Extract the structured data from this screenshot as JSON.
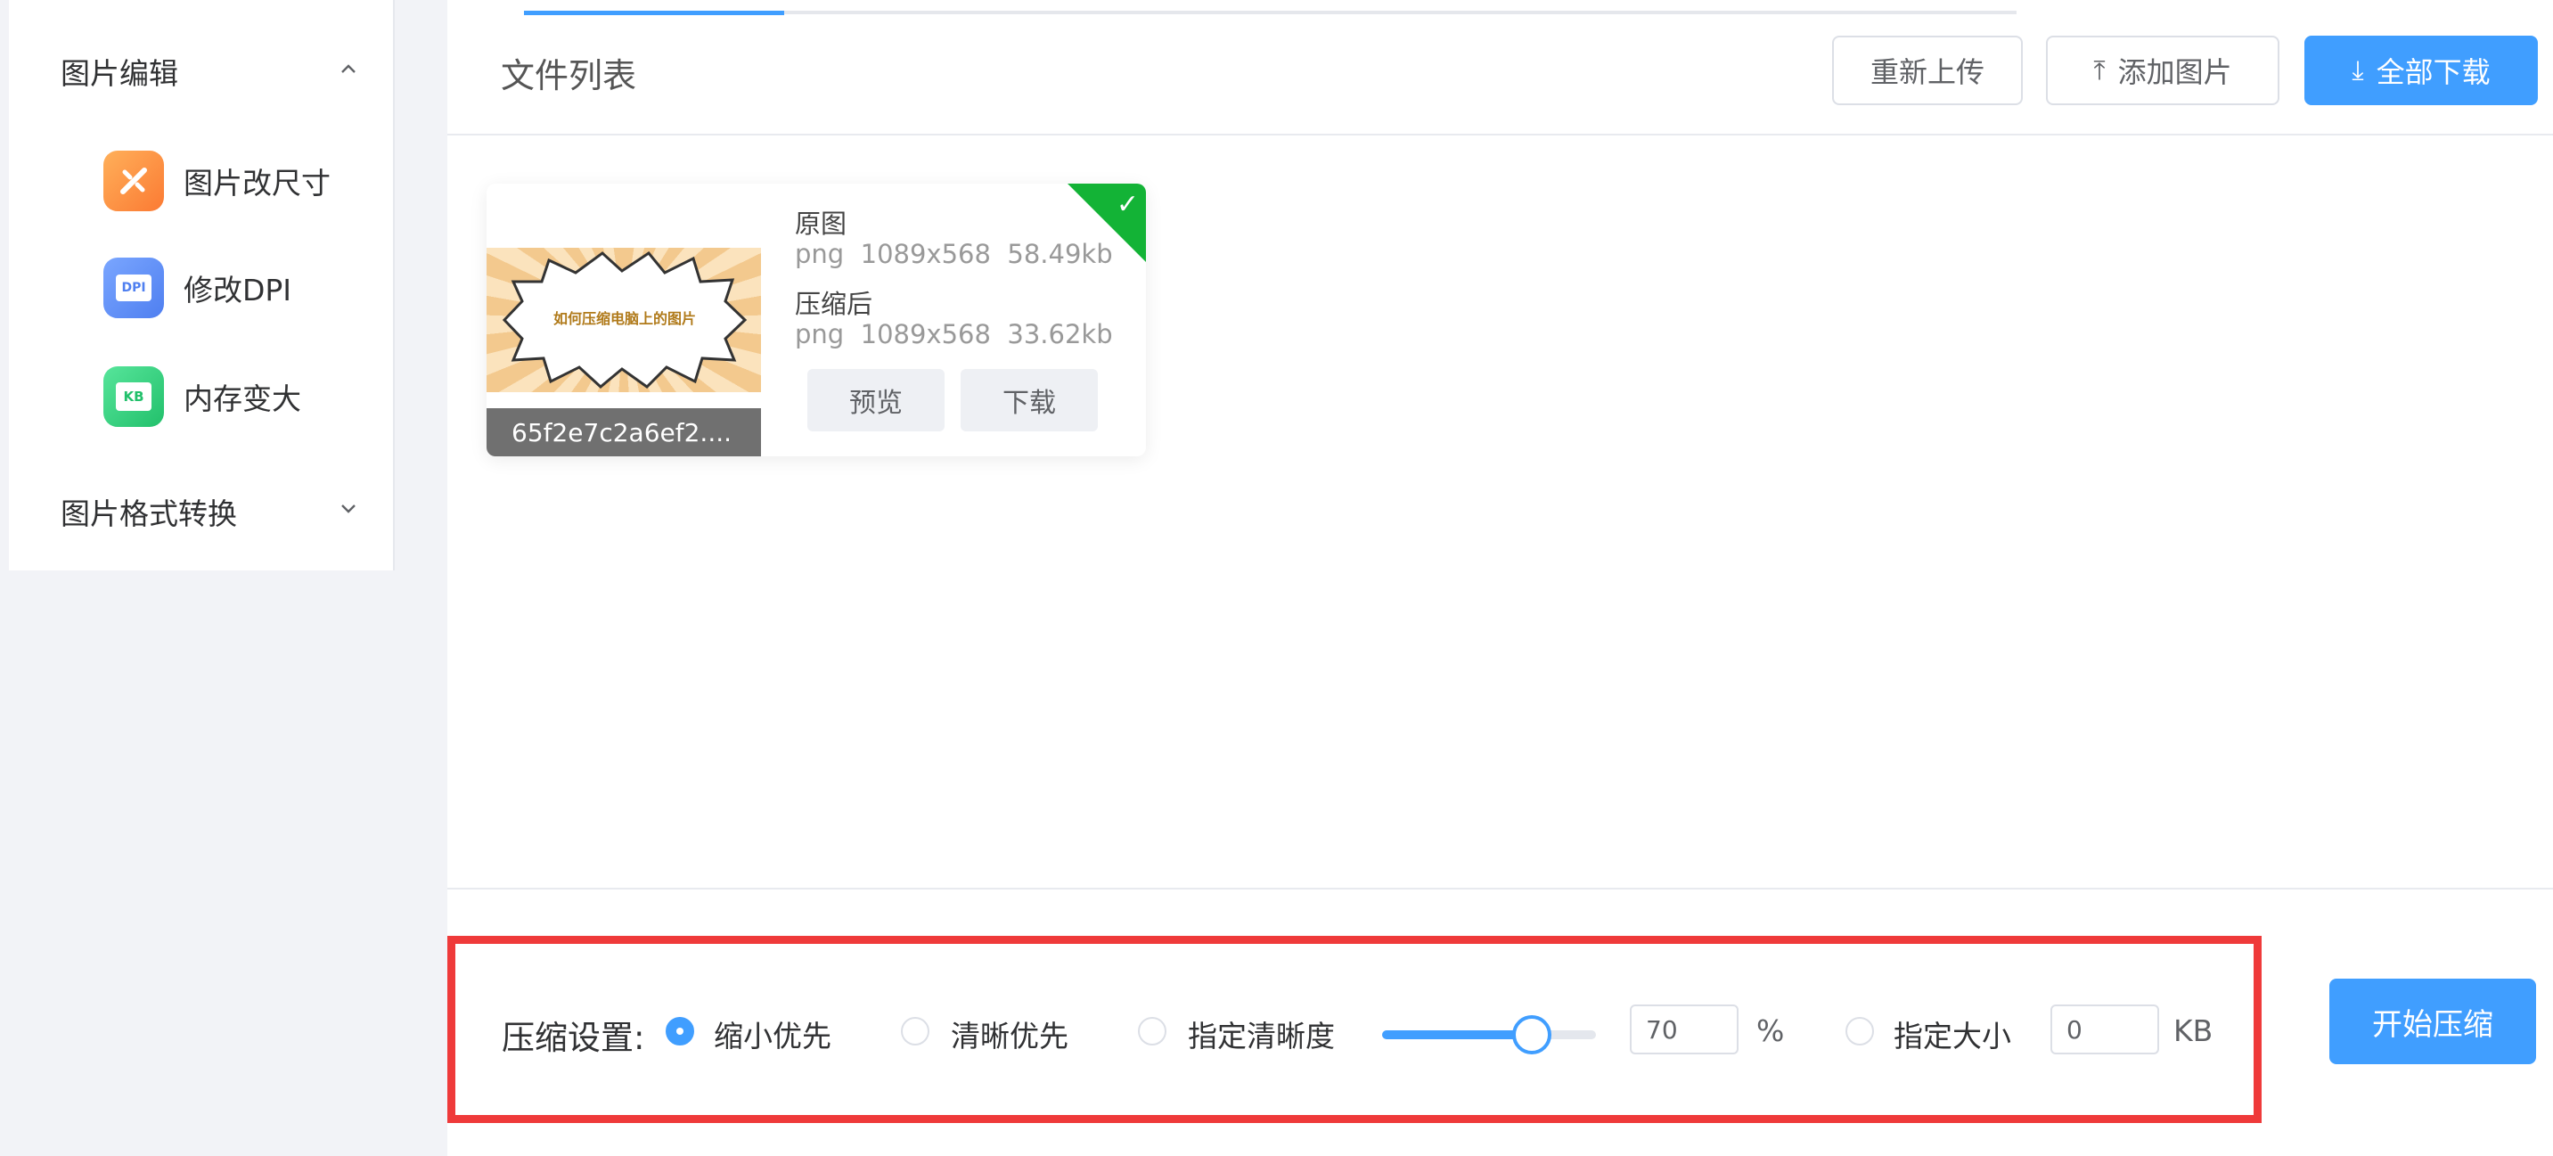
{
  "sidebar": {
    "group_edit": {
      "title": "图片编辑"
    },
    "items": [
      {
        "label": "图片改尺寸",
        "icon": "resize-icon",
        "color": "#fb8a3c"
      },
      {
        "label": "修改DPI",
        "icon": "dpi-icon",
        "color": "#5a8ff8",
        "badge": "DPI"
      },
      {
        "label": "内存变大",
        "icon": "kb-icon",
        "color": "#34d17c",
        "badge": "KB"
      }
    ],
    "group_convert": {
      "title": "图片格式转换"
    }
  },
  "header": {
    "title": "文件列表",
    "reupload_label": "重新上传",
    "add_label": "添加图片",
    "download_all_label": "全部下载"
  },
  "file_card": {
    "thumb_text": "如何压缩电脑上的图片",
    "filename": "65f2e7c2a6ef2....",
    "original_label": "原图",
    "original_meta": "png  1089x568  58.49kb",
    "compressed_label": "压缩后",
    "compressed_meta": "png  1089x568  33.62kb",
    "preview_label": "预览",
    "download_label": "下载",
    "status_color": "#13b336"
  },
  "settings": {
    "title": "压缩设置:",
    "options": [
      {
        "label": "缩小优先",
        "checked": true
      },
      {
        "label": "清晰优先",
        "checked": false
      },
      {
        "label": "指定清晰度",
        "checked": false
      },
      {
        "label": "指定大小",
        "checked": false
      }
    ],
    "quality_value": "70",
    "quality_unit": "%",
    "quality_level": 0.7,
    "size_value": "0",
    "size_unit": "KB",
    "start_label": "开始压缩",
    "highlight_color": "#ef3a3a"
  },
  "accent_color": "#409eff"
}
